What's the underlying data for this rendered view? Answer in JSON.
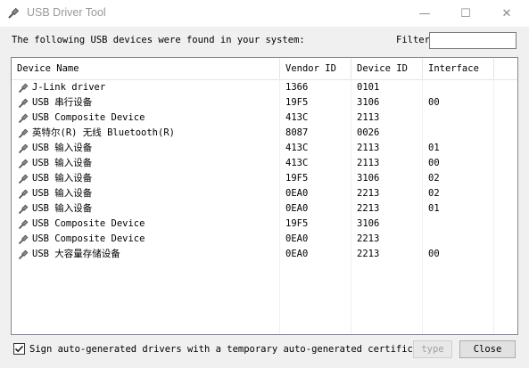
{
  "window": {
    "title": "USB Driver Tool",
    "minimize": "—",
    "maximize": "☐",
    "close": "✕"
  },
  "intro_text": "The following USB devices were found in your system:",
  "filter": {
    "label": "Filter",
    "value": ""
  },
  "table": {
    "columns": [
      "Device Name",
      "Vendor ID",
      "Device ID",
      "Interface"
    ],
    "rows": [
      {
        "name": "J-Link driver",
        "vendor": "1366",
        "device": "0101",
        "interface": ""
      },
      {
        "name": "USB 串行设备",
        "vendor": "19F5",
        "device": "3106",
        "interface": "00"
      },
      {
        "name": "USB Composite Device",
        "vendor": "413C",
        "device": "2113",
        "interface": ""
      },
      {
        "name": "英特尔(R) 无线 Bluetooth(R)",
        "vendor": "8087",
        "device": "0026",
        "interface": ""
      },
      {
        "name": "USB 输入设备",
        "vendor": "413C",
        "device": "2113",
        "interface": "01"
      },
      {
        "name": "USB 输入设备",
        "vendor": "413C",
        "device": "2113",
        "interface": "00"
      },
      {
        "name": "USB 输入设备",
        "vendor": "19F5",
        "device": "3106",
        "interface": "02"
      },
      {
        "name": "USB 输入设备",
        "vendor": "0EA0",
        "device": "2213",
        "interface": "02"
      },
      {
        "name": "USB 输入设备",
        "vendor": "0EA0",
        "device": "2213",
        "interface": "01"
      },
      {
        "name": "USB Composite Device",
        "vendor": "19F5",
        "device": "3106",
        "interface": ""
      },
      {
        "name": "USB Composite Device",
        "vendor": "0EA0",
        "device": "2213",
        "interface": ""
      },
      {
        "name": "USB 大容量存储设备",
        "vendor": "0EA0",
        "device": "2213",
        "interface": "00"
      }
    ]
  },
  "footer": {
    "checkbox_label": "Sign auto-generated drivers with a temporary auto-generated certificate",
    "checkbox_checked": true,
    "type_button": "type",
    "close_button": "Close"
  },
  "icons": {
    "app": "usb-plug-icon",
    "row": "usb-plug-icon"
  }
}
